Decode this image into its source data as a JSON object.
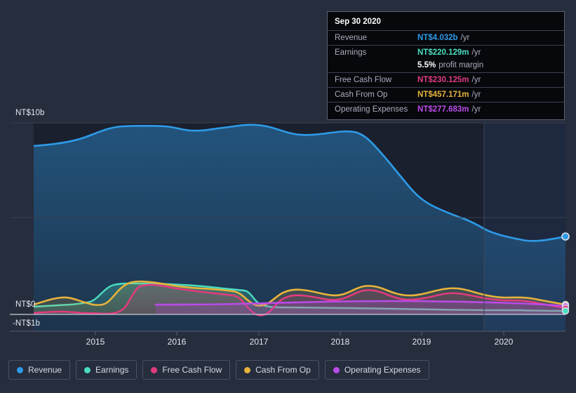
{
  "theme": {
    "page_bg": "#262D3D",
    "plot_bg": "#1A202E",
    "future_bg": "#1B2438",
    "grid": "#39404F",
    "zero_line": "#C9CEDA",
    "axis_text": "#E4E8F0"
  },
  "colors": {
    "revenue": "#2E9BE8",
    "earnings": "#4BDDBF",
    "free_cash_flow": "#E03B7E",
    "cash_from_op": "#E8B33C",
    "operating_expenses": "#BB4BE8"
  },
  "yaxis": {
    "top_label": "NT$10b",
    "zero_label": "NT$0",
    "bottom_label": "-NT$1b"
  },
  "xaxis": {
    "ticks": [
      "2015",
      "2016",
      "2017",
      "2018",
      "2019",
      "2020"
    ]
  },
  "tooltip": {
    "date": "Sep 30 2020",
    "rows": [
      {
        "name": "Revenue",
        "value": "NT$4.032b",
        "unit": "/yr",
        "color_key": "revenue"
      },
      {
        "name": "Earnings",
        "value": "NT$220.129m",
        "unit": "/yr",
        "color_key": "earnings"
      },
      {
        "name": "Free Cash Flow",
        "value": "NT$230.125m",
        "unit": "/yr",
        "color_key": "free_cash_flow"
      },
      {
        "name": "Cash From Op",
        "value": "NT$457.171m",
        "unit": "/yr",
        "color_key": "cash_from_op"
      },
      {
        "name": "Operating Expenses",
        "value": "NT$277.683m",
        "unit": "/yr",
        "color_key": "operating_expenses"
      }
    ],
    "margin_value": "5.5%",
    "margin_label": "profit margin"
  },
  "legend": {
    "items": [
      {
        "label": "Revenue",
        "color_key": "revenue"
      },
      {
        "label": "Earnings",
        "color_key": "earnings"
      },
      {
        "label": "Free Cash Flow",
        "color_key": "free_cash_flow"
      },
      {
        "label": "Cash From Op",
        "color_key": "cash_from_op"
      },
      {
        "label": "Operating Expenses",
        "color_key": "operating_expenses"
      }
    ]
  },
  "chart_data": {
    "type": "area",
    "title": "",
    "xlabel": "",
    "ylabel": "NT$",
    "ylim": [
      -1,
      11
    ],
    "grid": true,
    "legend_position": "bottom",
    "currency": "NT$",
    "units": "billions",
    "x": [
      "2014.3",
      "2014.5",
      "2014.75",
      "2015.0",
      "2015.25",
      "2015.5",
      "2015.75",
      "2016.0",
      "2016.25",
      "2016.5",
      "2016.75",
      "2017.0",
      "2017.25",
      "2017.5",
      "2017.75",
      "2018.0",
      "2018.25",
      "2018.5",
      "2018.75",
      "2019.0",
      "2019.25",
      "2019.5",
      "2019.75",
      "2020.0",
      "2020.25",
      "2020.5",
      "2020.75"
    ],
    "series": [
      {
        "name": "Revenue",
        "color_key": "revenue",
        "values": [
          9.05,
          9.12,
          9.2,
          9.45,
          9.85,
          10.0,
          9.95,
          9.98,
          9.85,
          9.82,
          9.88,
          10.05,
          9.95,
          9.8,
          9.72,
          9.6,
          9.3,
          8.7,
          8.05,
          7.6,
          7.25,
          7.0,
          6.6,
          6.05,
          5.4,
          4.75,
          4.032
        ]
      },
      {
        "name": "Earnings",
        "color_key": "earnings",
        "values": [
          0.38,
          0.4,
          0.42,
          0.48,
          0.9,
          0.92,
          0.9,
          0.88,
          0.86,
          0.82,
          0.78,
          0.72,
          0.4,
          0.32,
          0.3,
          0.3,
          0.3,
          0.3,
          0.3,
          0.28,
          0.26,
          0.25,
          0.24,
          0.23,
          0.22,
          0.22,
          0.2201
        ]
      },
      {
        "name": "Free Cash Flow",
        "color_key": "free_cash_flow",
        "values": [
          0.1,
          0.12,
          0.15,
          0.2,
          0.1,
          0.05,
          0.55,
          0.82,
          0.8,
          0.78,
          0.74,
          0.68,
          0.1,
          -0.18,
          0.15,
          0.42,
          0.45,
          0.38,
          0.35,
          0.5,
          0.55,
          0.42,
          0.33,
          0.35,
          0.42,
          0.35,
          0.2301
        ]
      },
      {
        "name": "Cash From Op",
        "color_key": "cash_from_op",
        "values": [
          0.35,
          0.45,
          0.52,
          0.48,
          0.35,
          0.45,
          0.78,
          0.98,
          0.95,
          0.92,
          0.88,
          0.82,
          0.55,
          0.3,
          0.45,
          0.6,
          0.62,
          0.55,
          0.52,
          0.68,
          0.72,
          0.6,
          0.5,
          0.55,
          0.62,
          0.55,
          0.4572
        ]
      },
      {
        "name": "Operating Expenses",
        "color_key": "operating_expenses",
        "values": [
          null,
          null,
          null,
          null,
          null,
          null,
          null,
          0.25,
          0.25,
          0.26,
          0.26,
          0.26,
          0.27,
          0.27,
          0.3,
          0.32,
          0.33,
          0.33,
          0.33,
          0.34,
          0.34,
          0.33,
          0.32,
          0.31,
          0.3,
          0.29,
          0.2777
        ]
      }
    ]
  }
}
